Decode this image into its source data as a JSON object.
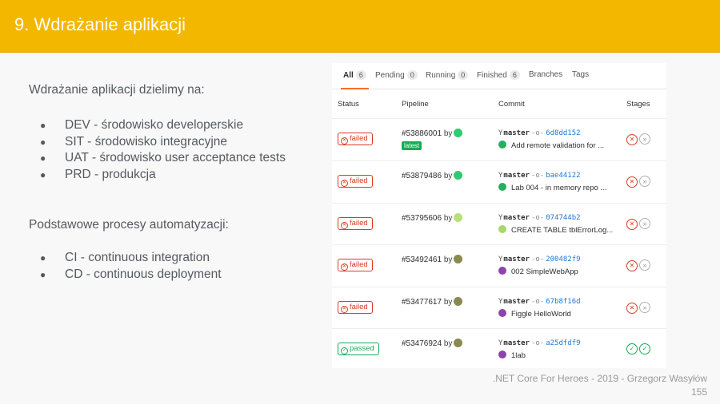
{
  "slide": {
    "title": "9. Wdrażanie aplikacji",
    "intro": "Wdrażanie aplikacji dzielimy na:",
    "environments": [
      "DEV - środowisko developerskie",
      "SIT - środowisko integracyjne",
      "UAT - środowisko user acceptance tests",
      "PRD - produkcja"
    ],
    "processes_heading": "Podstawowe procesy automatyzacji:",
    "processes": [
      "CI - continuous integration",
      "CD - continuous deployment"
    ],
    "footer": ".NET Core For Heroes - 2019 - Grzegorz Wasyłów",
    "page_number": "155"
  },
  "tabs": [
    {
      "label": "All",
      "count": "6"
    },
    {
      "label": "Pending",
      "count": "0"
    },
    {
      "label": "Running",
      "count": "0"
    },
    {
      "label": "Finished",
      "count": "6"
    },
    {
      "label": "Branches",
      "count": null
    },
    {
      "label": "Tags",
      "count": null
    }
  ],
  "columns": {
    "status": "Status",
    "pipeline": "Pipeline",
    "commit": "Commit",
    "stages": "Stages"
  },
  "by_label": "by",
  "latest_label": "latest",
  "rows": [
    {
      "status": "failed",
      "status_icon": "x",
      "pipeline": "#53886001",
      "branch": "master",
      "sha": "6d8dd152",
      "message": "Add remote validation for ...",
      "avatar_color": "#2ecc71",
      "commit_avatar_color": "#27ae60",
      "stages": [
        "x",
        "»"
      ]
    },
    {
      "status": "failed",
      "status_icon": "x",
      "pipeline": "#53879486",
      "branch": "master",
      "sha": "bae44122",
      "message": "Lab 004 - in memory repo ...",
      "avatar_color": "#2ecc71",
      "commit_avatar_color": "#27ae60",
      "stages": [
        "x",
        "»"
      ]
    },
    {
      "status": "failed",
      "status_icon": "x",
      "pipeline": "#53795606",
      "branch": "master",
      "sha": "074744b2",
      "message": "CREATE TABLE tblErrorLog...",
      "avatar_color": "#b8e07a",
      "commit_avatar_color": "#a6d96a",
      "stages": [
        "x",
        "»"
      ]
    },
    {
      "status": "failed",
      "status_icon": "x",
      "pipeline": "#53492461",
      "branch": "master",
      "sha": "200482f9",
      "message": "002 SimpleWebApp",
      "avatar_color": "#8a8a50",
      "commit_avatar_color": "#8e44ad",
      "stages": [
        "x",
        "»"
      ]
    },
    {
      "status": "failed",
      "status_icon": "x",
      "pipeline": "#53477617",
      "branch": "master",
      "sha": "67b8f16d",
      "message": "Figgle HelloWorld",
      "avatar_color": "#8a8a50",
      "commit_avatar_color": "#8e44ad",
      "stages": [
        "x",
        "»"
      ]
    },
    {
      "status": "passed",
      "status_icon": "check",
      "pipeline": "#53476924",
      "branch": "master",
      "sha": "a25dfdf9",
      "message": "1lab",
      "avatar_color": "#8a8a50",
      "commit_avatar_color": "#8e44ad",
      "stages": [
        "✓",
        "✓"
      ]
    }
  ],
  "colors": {
    "accent": "#f3b700",
    "failed": "#db3b21",
    "passed": "#1aaa55",
    "sha_link": "#1f78d1"
  }
}
